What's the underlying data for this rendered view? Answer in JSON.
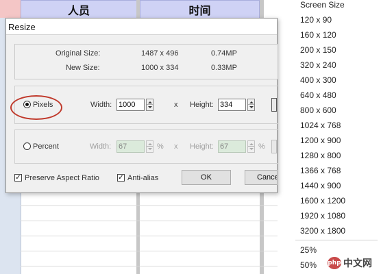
{
  "spreadsheet": {
    "headers": [
      "人员",
      "时间"
    ]
  },
  "dialog": {
    "title": "Resize",
    "original_size_label": "Original Size:",
    "original_size_dims": "1487 x 496",
    "original_size_mp": "0.74MP",
    "new_size_label": "New Size:",
    "new_size_dims": "1000 x 334",
    "new_size_mp": "0.33MP",
    "pixels_label": "Pixels",
    "pixels_selected": true,
    "width_label": "Width:",
    "width_value": "1000",
    "x_label": "x",
    "height_label": "Height:",
    "height_value": "334",
    "percent_label": "Percent",
    "percent_width_value": "67",
    "percent_height_value": "67",
    "percent_sign": "%",
    "preserve_label": "Preserve Aspect Ratio",
    "preserve_checked": true,
    "antialias_label": "Anti-alias",
    "antialias_checked": true,
    "ok_label": "OK",
    "cancel_label": "Cance"
  },
  "menu": {
    "items": [
      "Screen Size",
      "120 x 90",
      "160 x 120",
      "200 x 150",
      "320 x 240",
      "400 x 300",
      "640 x 480",
      "800 x 600",
      "1024 x 768",
      "1200 x 900",
      "1280 x 800",
      "1366 x 768",
      "1440 x 900",
      "1600 x 1200",
      "1920 x 1080",
      "3200 x 1800"
    ],
    "zoom_items": [
      "25%",
      "50%"
    ]
  },
  "watermark": {
    "text": "中文网",
    "logo": "php"
  },
  "colors": {
    "header_bg": "#cfd2f5",
    "annotation": "#c0392b",
    "disabled_field": "#dbeadb"
  }
}
